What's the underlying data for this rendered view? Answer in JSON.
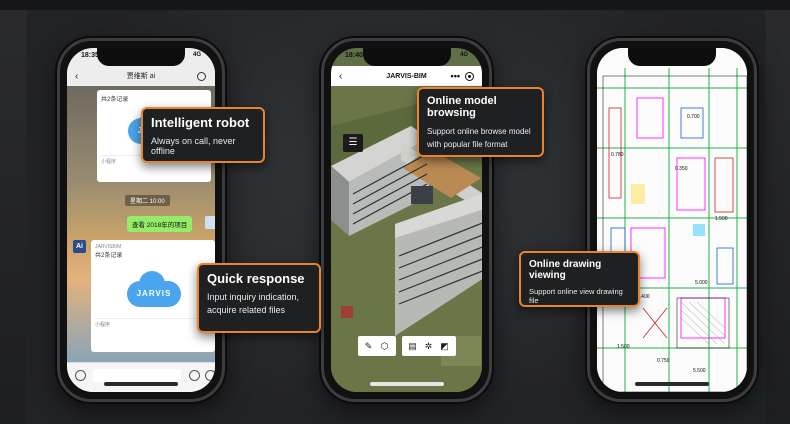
{
  "phone_chat": {
    "status_time": "18:35",
    "status_signal": "4G",
    "header_title": "贾维斯 ai",
    "card_top": {
      "title": "共2条记录",
      "logo": "JARVIS",
      "footer": "小程序"
    },
    "time_stamp": "星期二 10:00",
    "user_message": "查看 2018年的项目",
    "ai_label": "Ai",
    "card_bottom": {
      "sender": "JARVISBIM",
      "title": "共2条记录",
      "logo": "JARVIS",
      "footer": "小程序"
    }
  },
  "phone_model": {
    "status_time": "18:40",
    "status_signal": "4G",
    "header_title": "JARVIS-BIM",
    "header_more": "•••",
    "tree_icon": "tree-structure-icon"
  },
  "phone_drawing": {
    "labels": [
      "0.700",
      "0.780",
      "0.350",
      "1.500",
      "5.000",
      "2.400",
      "1.500",
      "0.750",
      "5.500"
    ]
  },
  "callouts": {
    "intelligent_robot": {
      "title": "Intelligent robot",
      "subtitle": "Always on call, never offline"
    },
    "quick_response": {
      "title": "Quick response",
      "line1": "Input inquiry indication,",
      "line2": "acquire related files"
    },
    "online_model": {
      "title": "Online model browsing",
      "line1": "Support online browse model",
      "line2": "with popular file format"
    },
    "online_drawing": {
      "title": "Online drawing viewing",
      "subtitle": "Support online view drawing file"
    }
  },
  "colors": {
    "accent": "#e8842b",
    "chat_green": "#95ec69",
    "cloud_blue": "#4aa4ee"
  }
}
